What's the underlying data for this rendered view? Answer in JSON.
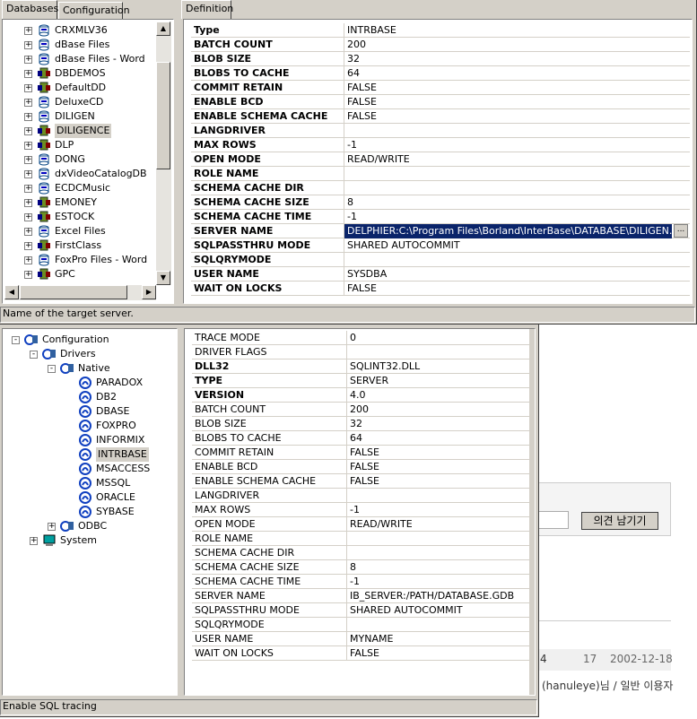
{
  "top_window": {
    "tabs": [
      "Databases",
      "Configuration"
    ],
    "definition_tab": "Definition",
    "tree_items": [
      {
        "label": "CRXMLV36",
        "icon": "database-icon"
      },
      {
        "label": "dBase Files",
        "icon": "database-icon"
      },
      {
        "label": "dBase Files - Word",
        "icon": "database-icon"
      },
      {
        "label": "DBDEMOS",
        "icon": "database-open-icon"
      },
      {
        "label": "DefaultDD",
        "icon": "database-open-icon"
      },
      {
        "label": "DeluxeCD",
        "icon": "database-icon"
      },
      {
        "label": "DILIGEN",
        "icon": "database-icon"
      },
      {
        "label": "DILIGENCE",
        "icon": "database-open-icon"
      },
      {
        "label": "DLP",
        "icon": "database-open-icon"
      },
      {
        "label": "DONG",
        "icon": "database-icon"
      },
      {
        "label": "dxVideoCatalogDB",
        "icon": "database-icon"
      },
      {
        "label": "ECDCMusic",
        "icon": "database-icon"
      },
      {
        "label": "EMONEY",
        "icon": "database-open-icon"
      },
      {
        "label": "ESTOCK",
        "icon": "database-open-icon"
      },
      {
        "label": "Excel Files",
        "icon": "database-icon"
      },
      {
        "label": "FirstClass",
        "icon": "database-open-icon"
      },
      {
        "label": "FoxPro Files - Word",
        "icon": "database-icon"
      },
      {
        "label": "GPC",
        "icon": "database-open-icon"
      }
    ],
    "properties": [
      [
        "Type",
        "INTRBASE"
      ],
      [
        "BATCH COUNT",
        "200"
      ],
      [
        "BLOB SIZE",
        "32"
      ],
      [
        "BLOBS TO CACHE",
        "64"
      ],
      [
        "COMMIT RETAIN",
        "FALSE"
      ],
      [
        "ENABLE BCD",
        "FALSE"
      ],
      [
        "ENABLE SCHEMA CACHE",
        "FALSE"
      ],
      [
        "LANGDRIVER",
        ""
      ],
      [
        "MAX ROWS",
        "-1"
      ],
      [
        "OPEN MODE",
        "READ/WRITE"
      ],
      [
        "ROLE NAME",
        ""
      ],
      [
        "SCHEMA CACHE DIR",
        ""
      ],
      [
        "SCHEMA CACHE SIZE",
        "8"
      ],
      [
        "SCHEMA CACHE TIME",
        "-1"
      ],
      [
        "SERVER NAME",
        "DELPHIER:C:\\Program Files\\Borland\\InterBase\\DATABASE\\DILIGEN.GDB"
      ],
      [
        "SQLPASSTHRU MODE",
        "SHARED AUTOCOMMIT"
      ],
      [
        "SQLQRYMODE",
        ""
      ],
      [
        "USER NAME",
        "SYSDBA"
      ],
      [
        "WAIT ON LOCKS",
        "FALSE"
      ]
    ],
    "ellipsis": "...",
    "status": "Name of the target server."
  },
  "bottom_window": {
    "tree": [
      {
        "label": "Configuration",
        "level": 0,
        "icon": "config-icon",
        "exp": "-"
      },
      {
        "label": "Drivers",
        "level": 1,
        "icon": "drivers-icon",
        "exp": "-"
      },
      {
        "label": "Native",
        "level": 2,
        "icon": "drivers-icon",
        "exp": "-"
      },
      {
        "label": "PARADOX",
        "level": 3,
        "icon": "driver-icon"
      },
      {
        "label": "DB2",
        "level": 3,
        "icon": "driver-icon"
      },
      {
        "label": "DBASE",
        "level": 3,
        "icon": "driver-icon"
      },
      {
        "label": "FOXPRO",
        "level": 3,
        "icon": "driver-icon"
      },
      {
        "label": "INFORMIX",
        "level": 3,
        "icon": "driver-icon"
      },
      {
        "label": "INTRBASE",
        "level": 3,
        "icon": "driver-icon",
        "selected": true
      },
      {
        "label": "MSACCESS",
        "level": 3,
        "icon": "driver-icon"
      },
      {
        "label": "MSSQL",
        "level": 3,
        "icon": "driver-icon"
      },
      {
        "label": "ORACLE",
        "level": 3,
        "icon": "driver-icon"
      },
      {
        "label": "SYBASE",
        "level": 3,
        "icon": "driver-icon"
      },
      {
        "label": "ODBC",
        "level": 2,
        "icon": "drivers-icon",
        "exp": "+"
      },
      {
        "label": "System",
        "level": 1,
        "icon": "computer-icon",
        "exp": "+"
      }
    ],
    "properties": [
      [
        "TRACE MODE",
        "0",
        false
      ],
      [
        "DRIVER FLAGS",
        "",
        false
      ],
      [
        "DLL32",
        "SQLINT32.DLL",
        true
      ],
      [
        "TYPE",
        "SERVER",
        true
      ],
      [
        "VERSION",
        "4.0",
        true
      ],
      [
        "BATCH COUNT",
        "200",
        false
      ],
      [
        "BLOB SIZE",
        "32",
        false
      ],
      [
        "BLOBS TO CACHE",
        "64",
        false
      ],
      [
        "COMMIT RETAIN",
        "FALSE",
        false
      ],
      [
        "ENABLE BCD",
        "FALSE",
        false
      ],
      [
        "ENABLE SCHEMA CACHE",
        "FALSE",
        false
      ],
      [
        "LANGDRIVER",
        "",
        false
      ],
      [
        "MAX ROWS",
        "-1",
        false
      ],
      [
        "OPEN MODE",
        "READ/WRITE",
        false
      ],
      [
        "ROLE NAME",
        "",
        false
      ],
      [
        "SCHEMA CACHE DIR",
        "",
        false
      ],
      [
        "SCHEMA CACHE SIZE",
        "8",
        false
      ],
      [
        "SCHEMA CACHE TIME",
        "-1",
        false
      ],
      [
        "SERVER NAME",
        "IB_SERVER:/PATH/DATABASE.GDB",
        false
      ],
      [
        "SQLPASSTHRU MODE",
        "SHARED AUTOCOMMIT",
        false
      ],
      [
        "SQLQRYMODE",
        "",
        false
      ],
      [
        "USER NAME",
        "MYNAME",
        false
      ],
      [
        "WAIT ON LOCKS",
        "FALSE",
        false
      ]
    ],
    "status": "Enable SQL tracing"
  },
  "background_page": {
    "button": "의견 남기기",
    "row_num": "4",
    "row_count": "17",
    "row_date": "2002-12-18",
    "author": "(hanuleye)님 / 일반 이용자"
  }
}
